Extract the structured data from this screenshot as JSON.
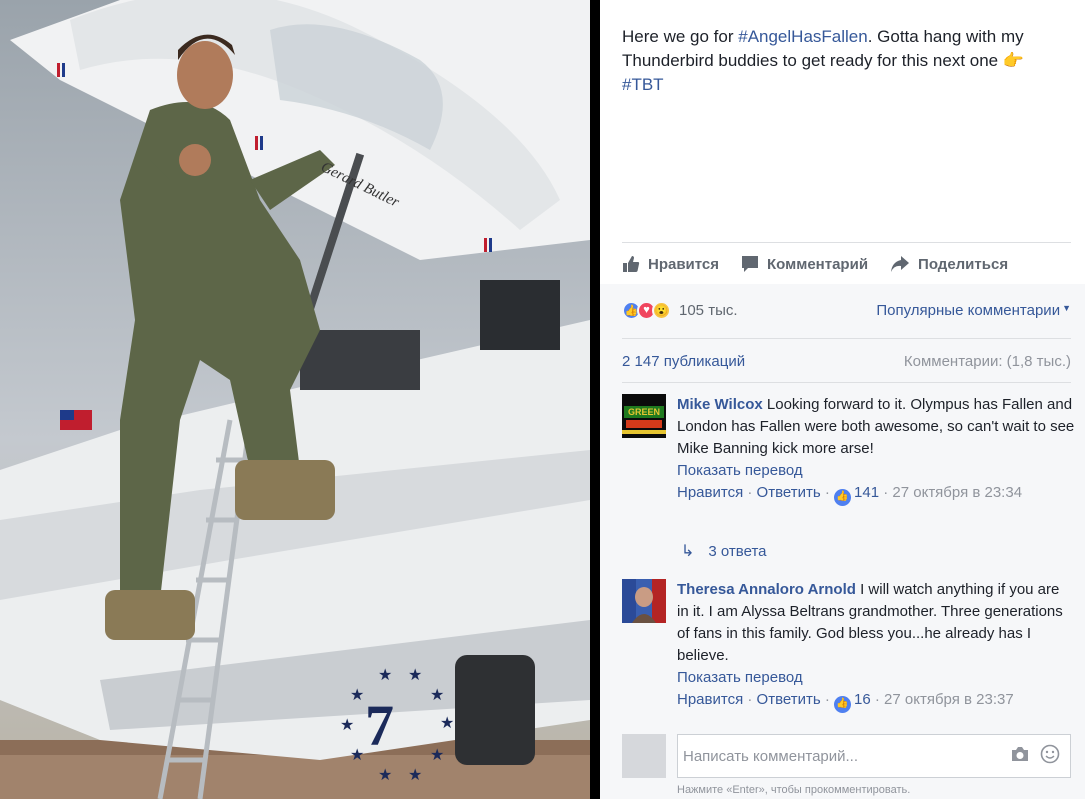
{
  "post": {
    "text_plain_1": "Here we go for ",
    "hashtag_1": "#AngelHasFallen",
    "text_plain_2": ". Gotta hang with my Thunderbird buddies to get ready for this next one ",
    "emoji": "👉",
    "hashtag_2": "#TBT"
  },
  "photo_texts": {
    "name_script": "Gerard Butler",
    "number": "7"
  },
  "actions": {
    "like": "Нравится",
    "comment": "Комментарий",
    "share": "Поделиться"
  },
  "reactions": {
    "count": "105 тыс.",
    "sort_label": "Популярные комментарии"
  },
  "stats": {
    "publications": "2 147 публикаций",
    "comments": "Комментарии: (1,8 тыс.)"
  },
  "comments": [
    {
      "author": "Mike Wilcox",
      "text": "Looking forward to it. Olympus has Fallen and London has Fallen were both awesome, so can't wait to see Mike Banning kick more arse!",
      "translate": "Показать перевод",
      "like_label": "Нравится",
      "reply_label": "Ответить",
      "likes": "141",
      "time": "27 октября в 23:34",
      "replies": "3 ответа",
      "avatar_text": "GREEN"
    },
    {
      "author": "Theresa Annaloro Arnold",
      "text": "I will watch anything if you are in it. I am Alyssa Beltrans grandmother. Three generations of fans in this family. God bless you...he already has I believe.",
      "translate": "Показать перевод",
      "like_label": "Нравится",
      "reply_label": "Ответить",
      "likes": "16",
      "time": "27 октября в 23:37"
    }
  ],
  "composer": {
    "placeholder": "Написать комментарий...",
    "hint": "Нажмите «Enter», чтобы прокомментировать."
  },
  "colors": {
    "link": "#365899",
    "text": "#1d2129",
    "muted": "#90949c",
    "comments_bg": "#f6f7f9"
  }
}
